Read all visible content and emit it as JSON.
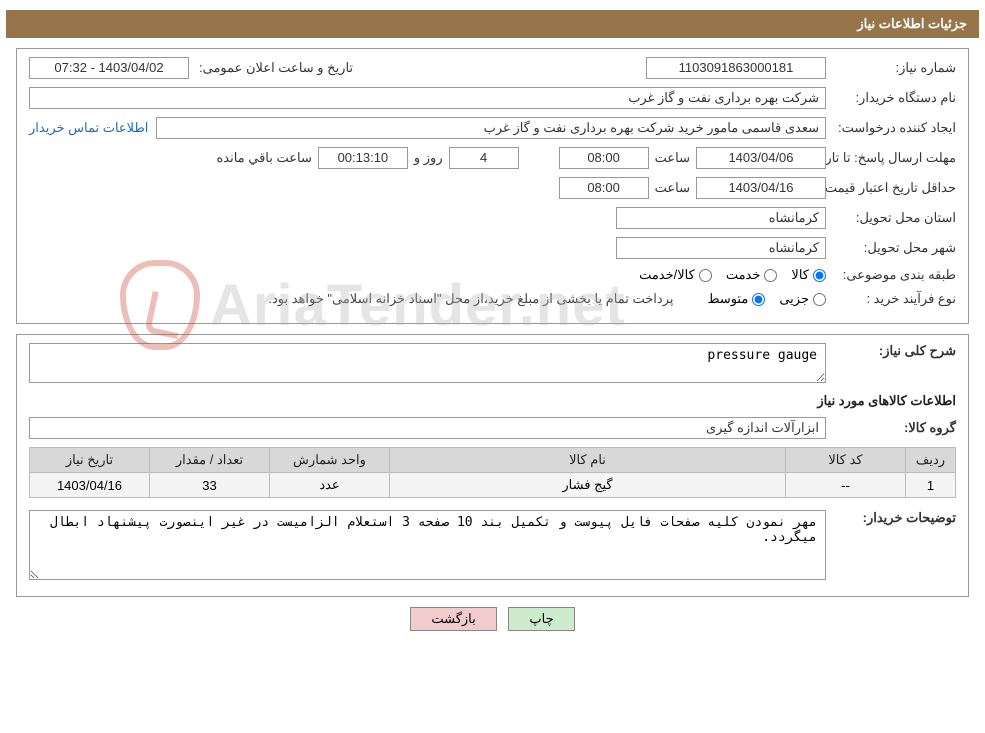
{
  "header": {
    "title": "جزئیات اطلاعات نیاز"
  },
  "labels": {
    "need_number": "شماره نیاز:",
    "announce_datetime": "تاریخ و ساعت اعلان عمومی:",
    "buyer_org": "نام دستگاه خریدار:",
    "requester": "ایجاد کننده درخواست:",
    "contact_link": "اطلاعات تماس خریدار",
    "reply_deadline": "مهلت ارسال پاسخ: تا تاریخ:",
    "time": "ساعت",
    "days_and": "روز و",
    "remaining": "ساعت باقي مانده",
    "min_valid": "حداقل تاریخ اعتبار قیمت: تا تاریخ:",
    "province": "استان محل تحویل:",
    "city": "شهر محل تحویل:",
    "subject_cat": "طبقه بندی موضوعی:",
    "cat_goods": "کالا",
    "cat_service": "خدمت",
    "cat_goods_service": "کالا/خدمت",
    "purchase_type": "نوع فرآیند خرید :",
    "pt_partial": "جزیی",
    "pt_medium": "متوسط",
    "pt_note": "پرداخت تمام یا بخشی از مبلغ خرید،از محل \"اسناد خزانه اسلامی\" خواهد بود.",
    "need_desc": "شرح کلی نیاز:",
    "items_info": "اطلاعات کالاهای مورد نیاز",
    "goods_group": "گروه کالا:",
    "buyer_notes": "توضیحات خریدار:"
  },
  "fields": {
    "need_number": "1103091863000181",
    "announce_datetime": "1403/04/02 - 07:32",
    "buyer_org": "شرکت بهره برداری نفت و گاز غرب",
    "requester": "سعدی قاسمی مامور خرید شرکت بهره برداری نفت و گاز غرب",
    "reply_date": "1403/04/06",
    "reply_time": "08:00",
    "remain_days": "4",
    "remain_time": "00:13:10",
    "min_valid_date": "1403/04/16",
    "min_valid_time": "08:00",
    "province": "کرمانشاه",
    "city": "کرمانشاه",
    "need_desc": "pressure gauge",
    "goods_group": "ابزارآلات اندازه گیری",
    "buyer_notes": "مهر نمودن کلیه صفحات فایل پیوست و تکمیل بند 10 صفحه 3 استعلام الزامیست در غیر اینصورت پیشنهاد ابطال میگردد."
  },
  "table": {
    "headers": {
      "row": "ردیف",
      "code": "کد کالا",
      "name": "نام کالا",
      "unit": "واحد شمارش",
      "qty": "تعداد / مقدار",
      "date": "تاریخ نیاز"
    },
    "rows": [
      {
        "row": "1",
        "code": "--",
        "name": "گیج فشار",
        "unit": "عدد",
        "qty": "33",
        "date": "1403/04/16"
      }
    ]
  },
  "buttons": {
    "print": "چاپ",
    "back": "بازگشت"
  },
  "watermark": "AriaTender.net"
}
